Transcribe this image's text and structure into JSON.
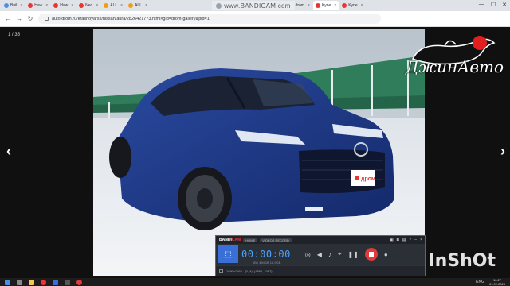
{
  "browser": {
    "tabs": [
      {
        "label": "Buil",
        "color": "#4a90e2"
      },
      {
        "label": "Haw",
        "color": "#e33"
      },
      {
        "label": "Haw",
        "color": "#e33"
      },
      {
        "label": "Neo",
        "color": "#e33"
      },
      {
        "label": "ALL",
        "color": "#f39c12"
      },
      {
        "label": "ALL",
        "color": "#f39c12"
      },
      {
        "label": "ALL",
        "color": "#f39c12"
      },
      {
        "label": "ALL",
        "color": "#f39c12"
      },
      {
        "label": "drom",
        "color": "#e33"
      },
      {
        "label": "Kyne",
        "color": "#e33",
        "active": true
      },
      {
        "label": "Kyne",
        "color": "#e33"
      }
    ],
    "bandicam_banner": "www.BANDICAM.com",
    "url": "auto.drom.ru/krasnoyarsk/nissan/aura/2826421773.html#gid=drom-gallery&pid=1"
  },
  "gallery": {
    "counter": "1 / 35",
    "prev_icon": "chevron-left-icon",
    "next_icon": "chevron-right-icon",
    "plate_text": "дром"
  },
  "bandicam": {
    "logo_main": "BANDI",
    "logo_accent": "CAM",
    "pills": [
      "HOME",
      "VIDEOS RECORD"
    ],
    "timer": "00:00:00",
    "subinfo": "0B / 494GB    18.9GB",
    "footer": "1890x1063 - (0, 4), (1890, 1067)"
  },
  "watermarks": {
    "channel": "ДжинАвто",
    "editor": "InShOt"
  },
  "taskbar": {
    "lang": "ENG",
    "time": "10:27",
    "date": "01.02.2023"
  },
  "colors": {
    "car_body": "#1d3a86",
    "accent_blue": "#3a6fd8",
    "record_red": "#e03a3a"
  }
}
